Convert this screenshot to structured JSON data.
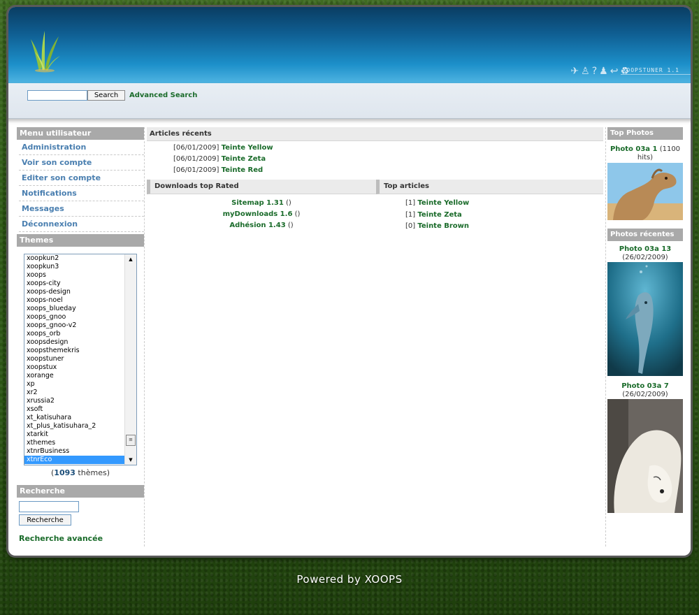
{
  "colors": {
    "accent_link": "#1a6b2a",
    "menu_link": "#4a7fb0",
    "block_header": "#a9a9a9",
    "header_blue": "#1c8fc9"
  },
  "header": {
    "logo_icon": "grass-logo-icon",
    "brand_icons": [
      "airplane-icon",
      "person-icon",
      "help-icon",
      "walking-person-icon",
      "return-icon",
      "recycle-icon"
    ],
    "brand_name": "XOOPSTUNER 1.1"
  },
  "topsearch": {
    "input_value": "",
    "button_label": "Search",
    "advanced_label": "Advanced Search"
  },
  "usermenu": {
    "title": "Menu utilisateur",
    "items": [
      "Administration",
      "Voir son compte",
      "Editer son compte",
      "Notifications",
      "Messages",
      "Déconnexion"
    ]
  },
  "themes": {
    "title": "Themes",
    "options": [
      "xoopkun2",
      "xoopkun3",
      "xoops",
      "xoops-city",
      "xoops-design",
      "xoops-noel",
      "xoops_blueday",
      "xoops_gnoo",
      "xoops_gnoo-v2",
      "xoops_orb",
      "xoopsdesign",
      "xoopsthemekris",
      "xoopstuner",
      "xoopstux",
      "xorange",
      "xp",
      "xr2",
      "xrussia2",
      "xsoft",
      "xt_katisuhara",
      "xt_plus_katisuhara_2",
      "xtarkit",
      "xthemes",
      "xtnrBusiness",
      "xtnrEco"
    ],
    "selected": "xtnrEco",
    "count": "1093",
    "count_suffix": "thèmes"
  },
  "search": {
    "title": "Recherche",
    "input_value": "",
    "button_label": "Recherche",
    "advanced_label": "Recherche avancée"
  },
  "recent_articles": {
    "title": "Articles récents",
    "items": [
      {
        "date": "[06/01/2009]",
        "title": "Teinte Yellow"
      },
      {
        "date": "[06/01/2009]",
        "title": "Teinte Zeta"
      },
      {
        "date": "[06/01/2009]",
        "title": "Teinte Red"
      }
    ]
  },
  "downloads": {
    "title": "Downloads top Rated",
    "items": [
      {
        "title": "Sitemap 1.31",
        "suffix": "()"
      },
      {
        "title": "myDownloads 1.6",
        "suffix": "()"
      },
      {
        "title": "Adhésion 1.43",
        "suffix": "()"
      }
    ]
  },
  "top_articles": {
    "title": "Top articles",
    "items": [
      {
        "rank": "[1]",
        "title": "Teinte Yellow"
      },
      {
        "rank": "[1]",
        "title": "Teinte Zeta"
      },
      {
        "rank": "[0]",
        "title": "Teinte Brown"
      }
    ]
  },
  "top_photos": {
    "title": "Top Photos",
    "photo_title": "Photo 03a 1",
    "hits": "(1100 hits)",
    "image": "camel-photo"
  },
  "recent_photos": {
    "title": "Photos récentes",
    "items": [
      {
        "title": "Photo 03a 13",
        "date": "(26/02/2009)",
        "image": "dolphin-photo"
      },
      {
        "title": "Photo 03a 7",
        "date": "(26/02/2009)",
        "image": "polar-bear-photo"
      }
    ]
  },
  "footer": {
    "text": "Powered by XOOPS"
  }
}
